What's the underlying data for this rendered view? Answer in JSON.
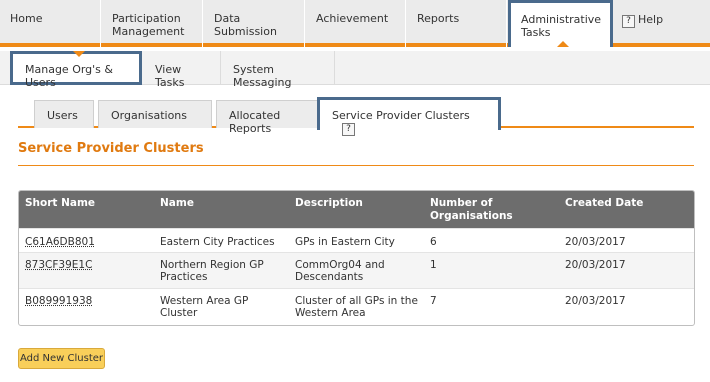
{
  "topnav": {
    "items": [
      {
        "label": "Home"
      },
      {
        "label": "Participation Management"
      },
      {
        "label": "Data Submission"
      },
      {
        "label": "Achievement"
      },
      {
        "label": "Reports"
      },
      {
        "label": "Administrative Tasks"
      }
    ],
    "help_label": "Help",
    "help_icon": "?"
  },
  "subnav": {
    "items": [
      {
        "label": "Manage Org's & Users"
      },
      {
        "label": "View Tasks"
      },
      {
        "label": "System Messaging"
      }
    ]
  },
  "tabs": [
    {
      "label": "Users"
    },
    {
      "label": "Organisations"
    },
    {
      "label": "Allocated Reports"
    },
    {
      "label": "Service Provider Clusters",
      "help_icon": "?"
    }
  ],
  "page_title": "Service Provider Clusters",
  "table": {
    "headers": [
      "Short Name",
      "Name",
      "Description",
      "Number of Organisations",
      "Created Date"
    ],
    "rows": [
      {
        "short_name": "C61A6DB801",
        "name": "Eastern City Practices",
        "description": "GPs in Eastern City",
        "count": "6",
        "created": "20/03/2017"
      },
      {
        "short_name": "873CF39E1C",
        "name": "Northern Region GP Practices",
        "description": "CommOrg04 and Descendants",
        "count": "1",
        "created": "20/03/2017"
      },
      {
        "short_name": "B089991938",
        "name": "Western Area GP Cluster",
        "description": "Cluster of all GPs in the Western Area",
        "count": "7",
        "created": "20/03/2017"
      }
    ]
  },
  "add_button_label": "Add New Cluster",
  "colors": {
    "accent": "#ef8a17",
    "highlight": "#4a6a8c",
    "button": "#f9cf5a",
    "header": "#6d6d6d"
  }
}
